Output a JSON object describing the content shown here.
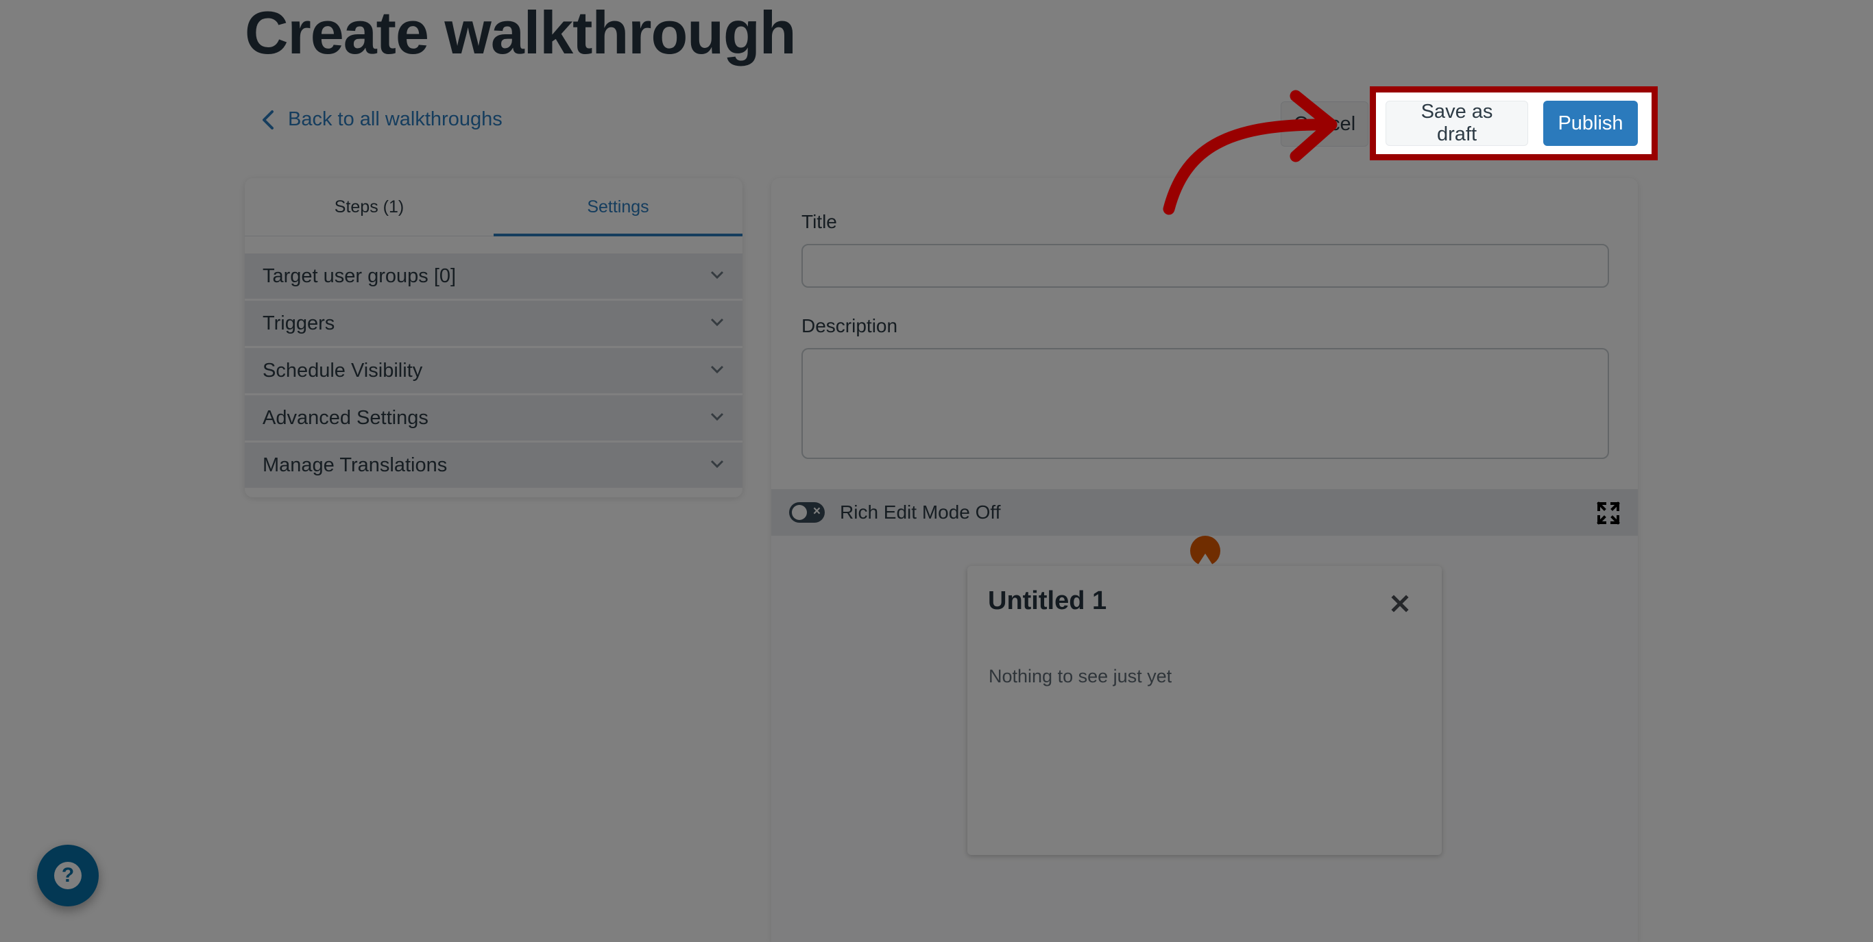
{
  "header": {
    "title": "Create walkthrough",
    "back_link": "Back to all walkthroughs"
  },
  "actions": {
    "cancel_label": "Cancel",
    "save_draft_label": "Save as draft",
    "publish_label": "Publish"
  },
  "left_panel": {
    "tabs": [
      {
        "label": "Steps (1)",
        "active": false
      },
      {
        "label": "Settings",
        "active": true
      }
    ],
    "sections": [
      {
        "label": "Target user groups [0]",
        "icon": "chevron-down-icon"
      },
      {
        "label": "Triggers",
        "icon": "chevron-down-icon"
      },
      {
        "label": "Schedule Visibility",
        "icon": "chevron-down-icon"
      },
      {
        "label": "Advanced Settings",
        "icon": "chevron-down-icon"
      },
      {
        "label": "Manage Translations",
        "icon": "chevron-down-icon"
      }
    ]
  },
  "form": {
    "title_label": "Title",
    "title_value": "",
    "description_label": "Description",
    "description_value": ""
  },
  "editor": {
    "rich_edit_label": "Rich Edit Mode Off",
    "rich_edit_on": false,
    "expand_icon": "expand-icon"
  },
  "preview": {
    "step_title": "Untitled 1",
    "step_body": "Nothing to see just yet",
    "close_icon": "close-icon"
  },
  "help": {
    "icon": "question-icon",
    "glyph": "?"
  },
  "colors": {
    "primary": "#2b7abc",
    "highlight": "#990000",
    "beacon": "#e05a00",
    "help": "#0770a8"
  }
}
